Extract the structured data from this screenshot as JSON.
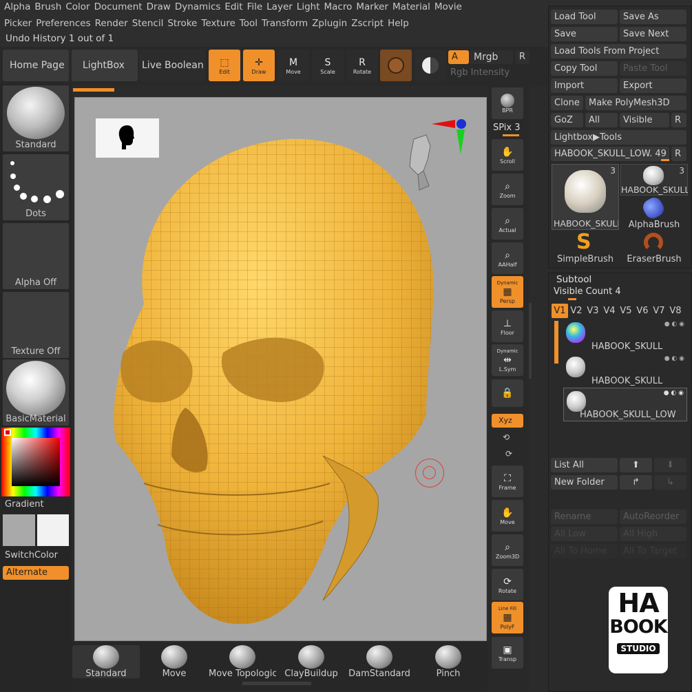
{
  "menu_row1": [
    "Alpha",
    "Brush",
    "Color",
    "Document",
    "Draw",
    "Dynamics",
    "Edit",
    "File",
    "Layer",
    "Light",
    "Macro",
    "Marker",
    "Material",
    "Movie"
  ],
  "menu_row2": [
    "Picker",
    "Preferences",
    "Render",
    "Stencil",
    "Stroke",
    "Texture",
    "Tool",
    "Transform",
    "Zplugin",
    "Zscript",
    "Help"
  ],
  "undo_history": "Undo History 1 out of 1",
  "shelf": {
    "home_page": "Home Page",
    "lightbox": "LightBox",
    "live_boolean": "Live Boolean",
    "edit": "Edit",
    "draw": "Draw",
    "move": "Move",
    "scale": "Scale",
    "rotate": "Rotate",
    "a_label": "A",
    "mrgb": "Mrgb",
    "r_label": "R",
    "rgb_intensity": "Rgb Intensity"
  },
  "left": {
    "brush": "Standard",
    "stroke": "Dots",
    "alpha": "Alpha Off",
    "texture": "Texture Off",
    "material": "BasicMaterial",
    "gradient": "Gradient",
    "switch_color": "SwitchColor",
    "alternate": "Alternate"
  },
  "right_shelf": {
    "bpr": "BPR",
    "spix": "SPix 3",
    "scroll": "Scroll",
    "zoom": "Zoom",
    "actual": "Actual",
    "aahalf": "AAHalf",
    "dynamic": "Dynamic",
    "persp": "Persp",
    "floor": "Floor",
    "dynamic2": "Dynamic",
    "lsym": "L.Sym",
    "xyz": "Xyz",
    "frame": "Frame",
    "move": "Move",
    "zoom3d": "Zoom3D",
    "rotate": "Rotate",
    "line_fill": "Line Fill",
    "polyf": "PolyF",
    "transp": "Transp"
  },
  "tool_panel": {
    "load_tool": "Load Tool",
    "save_as": "Save As",
    "save": "Save",
    "save_next": "Save Next",
    "load_from_project": "Load Tools From Project",
    "copy_tool": "Copy Tool",
    "paste_tool": "Paste Tool",
    "import": "Import",
    "export": "Export",
    "clone": "Clone",
    "make_polymesh": "Make PolyMesh3D",
    "goz": "GoZ",
    "all": "All",
    "visible": "Visible",
    "r": "R",
    "lightbox_tools": "Lightbox▶Tools",
    "current_tool": "HABOOK_SKULL_LOW. 49",
    "r2": "R",
    "thumbs": [
      {
        "label": "HABOOK_SKULL",
        "count": "3"
      },
      {
        "label": "HABOOK_SKULL",
        "count": "3"
      },
      {
        "label": "AlphaBrush",
        "count": ""
      },
      {
        "label": "SimpleBrush",
        "count": ""
      },
      {
        "label": "EraserBrush",
        "count": ""
      }
    ]
  },
  "subtool": {
    "title": "Subtool",
    "visible_count": "Visible Count 4",
    "tabs": [
      "V1",
      "V2",
      "V3",
      "V4",
      "V5",
      "V6",
      "V7",
      "V8"
    ],
    "items": [
      "HABOOK_SKULL",
      "HABOOK_SKULL",
      "HABOOK_SKULL_LOW"
    ],
    "list_all": "List All",
    "new_folder": "New Folder",
    "rename": "Rename",
    "auto_reorder": "AutoReorder",
    "all_low": "All Low",
    "all_high": "All High",
    "all_to_home": "All To Home",
    "all_to_target": "All To Target"
  },
  "brush_bar": [
    "Standard",
    "Move",
    "Move Topologic",
    "ClayBuildup",
    "DamStandard",
    "Pinch"
  ],
  "logo": {
    "line1": "HA",
    "line2": "BOOK",
    "line3": "STUDIO"
  },
  "colors": {
    "accent": "#f0902a",
    "panel": "#262626",
    "canvas": "#a5a5a5",
    "mesh": "#f0b43a"
  }
}
